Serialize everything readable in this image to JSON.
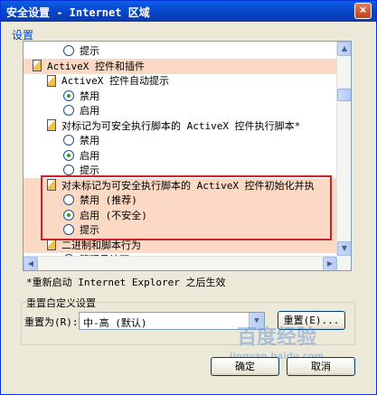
{
  "window": {
    "title": "安全设置 - Internet 区域",
    "close_glyph": "×"
  },
  "settings": {
    "group_label": "设置",
    "rows": [
      {
        "type": "radio",
        "label": "提示",
        "checked": false
      },
      {
        "type": "section",
        "label": "ActiveX 控件和插件"
      },
      {
        "type": "subsection",
        "label": "ActiveX 控件自动提示"
      },
      {
        "type": "radio",
        "label": "禁用",
        "checked": true
      },
      {
        "type": "radio",
        "label": "启用",
        "checked": false
      },
      {
        "type": "subsection",
        "label": "对标记为可安全执行脚本的 ActiveX 控件执行脚本*"
      },
      {
        "type": "radio",
        "label": "禁用",
        "checked": false
      },
      {
        "type": "radio",
        "label": "启用",
        "checked": true
      },
      {
        "type": "radio",
        "label": "提示",
        "checked": false
      },
      {
        "type": "subsection",
        "label": "对未标记为可安全执行脚本的 ActiveX 控件初始化并执"
      },
      {
        "type": "radio",
        "label": "禁用 (推荐)",
        "checked": false
      },
      {
        "type": "radio",
        "label": "启用 (不安全)",
        "checked": true
      },
      {
        "type": "radio",
        "label": "提示",
        "checked": false
      },
      {
        "type": "subsection",
        "label": "二进制和脚本行为"
      },
      {
        "type": "radio",
        "label": "管理员认可",
        "checked": false
      }
    ],
    "scroll_up_glyph": "▲",
    "scroll_down_glyph": "▼",
    "scroll_left_glyph": "◀",
    "scroll_right_glyph": "▶"
  },
  "restart_note": "*重新启动 Internet Explorer 之后生效",
  "reset": {
    "group_label": "重置自定义设置",
    "reset_to_label": "重置为(R):",
    "level_value": "中-高 (默认)",
    "dropdown_glyph": "▼",
    "reset_button": "重置(E)..."
  },
  "buttons": {
    "ok": "确定",
    "cancel": "取消"
  },
  "watermark": {
    "text": "百度经验",
    "sub": "jingyan.baidu.com"
  }
}
